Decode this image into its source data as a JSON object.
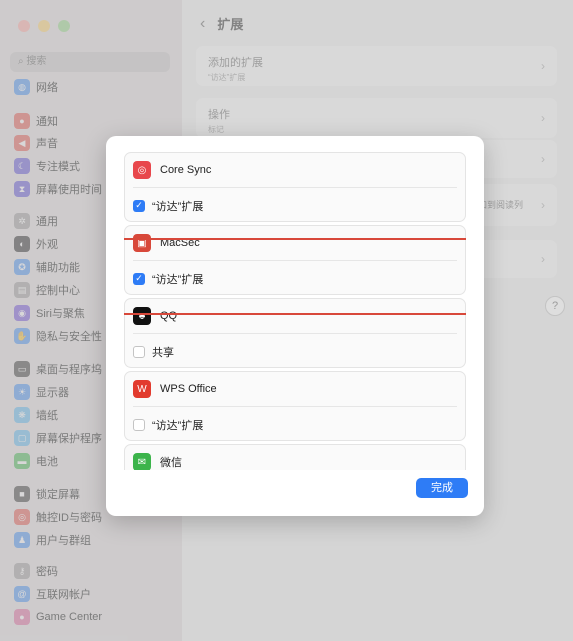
{
  "sidebar": {
    "search_placeholder": "搜索",
    "items": [
      {
        "label": "网络",
        "icon": "globe-icon",
        "color": "#3f8ef3"
      },
      {
        "label": "通知",
        "icon": "bell-icon",
        "color": "#e5534b"
      },
      {
        "label": "声音",
        "icon": "speaker-icon",
        "color": "#e5534b"
      },
      {
        "label": "专注模式",
        "icon": "moon-icon",
        "color": "#5b4fd6"
      },
      {
        "label": "屏幕使用时间",
        "icon": "hourglass-icon",
        "color": "#5b4fd6"
      },
      {
        "label": "通用",
        "icon": "gear-icon",
        "color": "#9a9a9a"
      },
      {
        "label": "外观",
        "icon": "appearance-icon",
        "color": "#222222"
      },
      {
        "label": "辅助功能",
        "icon": "accessibility-icon",
        "color": "#3f8ef3"
      },
      {
        "label": "控制中心",
        "icon": "control-center-icon",
        "color": "#9a9a9a"
      },
      {
        "label": "Siri与聚焦",
        "icon": "siri-icon",
        "color": "#6d4bd8"
      },
      {
        "label": "隐私与安全性",
        "icon": "hand-icon",
        "color": "#3f8ef3"
      },
      {
        "label": "桌面与程序坞",
        "icon": "dock-icon",
        "color": "#333333"
      },
      {
        "label": "显示器",
        "icon": "display-icon",
        "color": "#3f8ef3"
      },
      {
        "label": "墙纸",
        "icon": "wallpaper-icon",
        "color": "#5bb8f0"
      },
      {
        "label": "屏幕保护程序",
        "icon": "screensaver-icon",
        "color": "#5bb8f0"
      },
      {
        "label": "电池",
        "icon": "battery-icon",
        "color": "#3cb44b"
      },
      {
        "label": "锁定屏幕",
        "icon": "lock-icon",
        "color": "#333333"
      },
      {
        "label": "触控ID与密码",
        "icon": "fingerprint-icon",
        "color": "#e5534b"
      },
      {
        "label": "用户与群组",
        "icon": "users-icon",
        "color": "#3f8ef3"
      },
      {
        "label": "密码",
        "icon": "key-icon",
        "color": "#9a9a9a"
      },
      {
        "label": "互联网帐户",
        "icon": "at-icon",
        "color": "#3f8ef3"
      },
      {
        "label": "Game Center",
        "icon": "game-center-icon",
        "color": "#e0679e"
      }
    ]
  },
  "main": {
    "title": "扩展",
    "rows": [
      {
        "title": "添加的扩展",
        "subtitle": "“访达”扩展"
      },
      {
        "title": "操作",
        "subtitle": "标记"
      },
      {
        "title": "",
        "subtitle": ""
      },
      {
        "title": "添加到阅读列",
        "subtitle": ""
      },
      {
        "title": "",
        "subtitle": ""
      }
    ],
    "help": "?"
  },
  "dialog": {
    "extensions": [
      {
        "name": "Core Sync",
        "icon": "core-sync-icon",
        "color": "#e8474c",
        "option": "“访达”扩展",
        "checked": true
      },
      {
        "name": "MacSec",
        "icon": "macsec-icon",
        "color": "#d8483a",
        "option": "“访达”扩展",
        "checked": true
      },
      {
        "name": "QQ",
        "icon": "qq-penguin-icon",
        "color": "#111111",
        "option": "共享",
        "checked": false
      },
      {
        "name": "WPS Office",
        "icon": "wps-icon",
        "color": "#e23b2e",
        "option": "“访达”扩展",
        "checked": false
      },
      {
        "name": "微信",
        "icon": "wechat-icon",
        "color": "#3cb44b",
        "option": "",
        "checked": false
      }
    ],
    "done_label": "完成",
    "highlight_color": "#d8483a"
  }
}
